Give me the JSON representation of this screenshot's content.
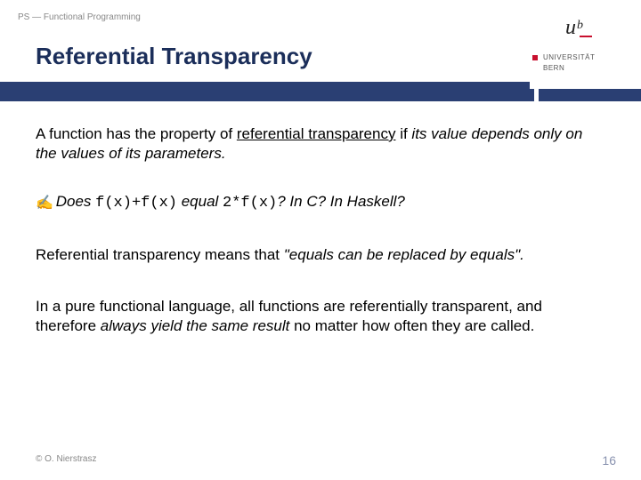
{
  "header": {
    "breadcrumb": "PS — Functional Programming",
    "title": "Referential Transparency"
  },
  "logo": {
    "u": "u",
    "b": "b",
    "line1": "UNIVERSITÄT",
    "line2": "BERN"
  },
  "body": {
    "p1_a": "A function has the property of ",
    "p1_b": "referential transparency",
    "p1_c": " if ",
    "p1_d": "its value depends only on the values of its parameters.",
    "hand": "✍",
    "p2_a": "Does ",
    "p2_code1": "f(x)+f(x)",
    "p2_b": " equal ",
    "p2_code2": "2*f(x)",
    "p2_c": "? In C? In Haskell?",
    "p3_a": "Referential transparency means that ",
    "p3_b": "\"equals can be replaced by equals\".",
    "p4_a": "In a pure functional language, all functions are referentially transparent, and therefore ",
    "p4_b": "always yield the same result",
    "p4_c": " no matter how often they are called."
  },
  "footer": {
    "copyright": "© O. Nierstrasz",
    "page": "16"
  }
}
